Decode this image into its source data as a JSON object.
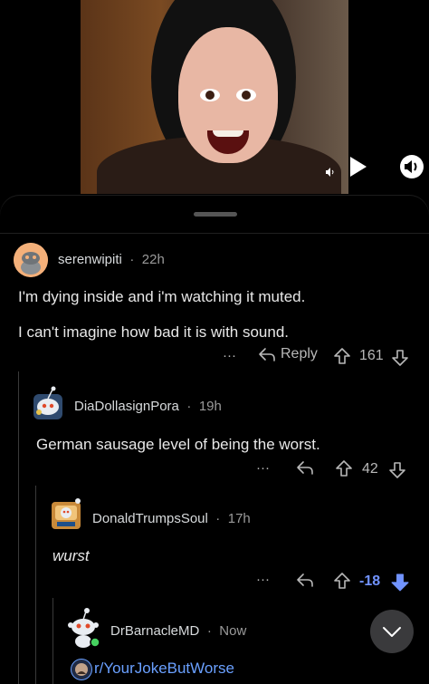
{
  "video": {
    "volume_icon": "speaker-icon",
    "play_icon": "play-icon",
    "sound_icon": "sound-on-icon"
  },
  "comments": [
    {
      "username": "serenwipiti",
      "time": "22h",
      "lines": [
        "I'm dying inside and i'm watching it muted.",
        "I can't imagine how bad it is with sound."
      ],
      "more": "···",
      "reply_label": "Reply",
      "votes": "161"
    },
    {
      "username": "DiaDollasignPora",
      "time": "19h",
      "lines": [
        "German sausage level of being the worst."
      ],
      "more": "···",
      "votes": "42"
    },
    {
      "username": "DonaldTrumpsSoul",
      "time": "17h",
      "lines": [
        "wurst"
      ],
      "more": "···",
      "votes": "-18"
    },
    {
      "username": "DrBarnacleMD",
      "time": "Now",
      "link": "r/YourJokeButWorse"
    }
  ],
  "separator": "·",
  "colors": {
    "downvote_active": "#7193ff",
    "link": "#6aa0ff"
  }
}
